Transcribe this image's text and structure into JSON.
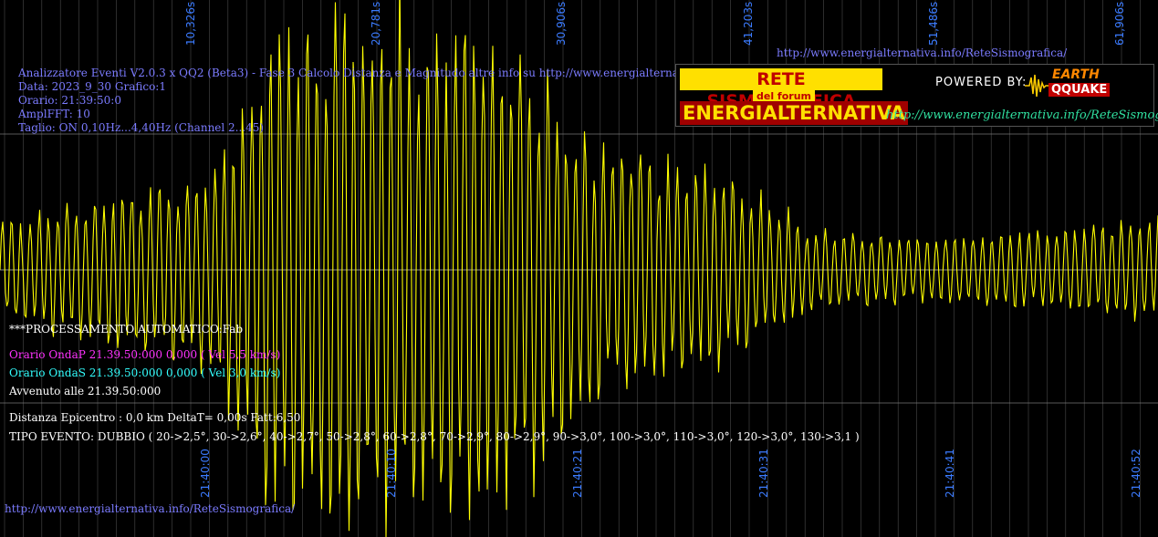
{
  "header": {
    "line1": "Analizzatore Eventi V2.0.3 x QQ2 (Beta3) - Fase 3 Calcolo Distanza e Magnitudo altre info su http://www.energialternativa.info/ReteSism",
    "line2": "Data: 2023_9_30 Grafico:1",
    "line3": "Orario: 21:39:50:0",
    "line4": "AmplFFT: 10",
    "line5": "Taglio: ON 0,10Hz...4,40Hz       (Channel 2...45)"
  },
  "top_url": "http://www.energialternativa.info/ReteSismografica/",
  "bottom_url": "http://www.energialternativa.info/ReteSismografica/",
  "processing": {
    "title": "***PROCESSAMENTO AUTOMATICO:Fab",
    "onda_p": "Orario OndaP 21.39.50:000  0,000 ( Vel 5,5 km/s)",
    "onda_s": "Orario OndaS 21.39.50:000  0,000 ( Vel 3,0 km/s)",
    "avvenuto": "Avvenuto alle 21.39.50:000",
    "distanza": "Distanza Epicentro : 0,0 km DeltaT= 0,00s  Fatt:6,50",
    "tipo": "TIPO EVENTO: DUBBIO ( 20->2,5°, 30->2,6°, 40->2,7°, 50->2,8°, 60->2,8°, 70->2,9°, 80->2,9°, 90->3,0°, 100->3,0°, 110->3,0°, 120->3,0°, 130->3,1 )"
  },
  "logo": {
    "line1": "RETE SISMOGRAFICA",
    "line2": "del forum",
    "line3": "ENERGIALTERNATIVA",
    "powered": "POWERED BY:",
    "earth": "EARTH",
    "quake": "QQUAKE",
    "url": "http://www.energialternativa.info/ReteSismografica"
  },
  "colors": {
    "trace": "#ffff00",
    "grid": "#4a4a4a",
    "tick": "#3b7bff"
  },
  "chart_data": {
    "type": "line",
    "top_tick_labels": [
      "10,326s",
      "20,781s",
      "30,906s",
      "41,203s",
      "51,486s",
      "61,906s"
    ],
    "bottom_tick_labels": [
      "21:40:00",
      "21:40:10",
      "21:40:21",
      "21:40:31",
      "21:40:41",
      "21:40:52"
    ],
    "envelope": {
      "t": [
        0,
        0.02,
        0.1,
        0.18,
        0.2,
        0.23,
        0.3,
        0.36,
        0.4,
        0.45,
        0.5,
        0.55,
        0.6,
        0.65,
        0.7,
        0.8,
        0.9,
        1.0
      ],
      "amp": [
        0.2,
        0.2,
        0.3,
        0.35,
        0.55,
        0.9,
        1.0,
        0.9,
        0.95,
        0.85,
        0.5,
        0.45,
        0.38,
        0.3,
        0.15,
        0.12,
        0.15,
        0.2
      ]
    },
    "grid": true
  }
}
